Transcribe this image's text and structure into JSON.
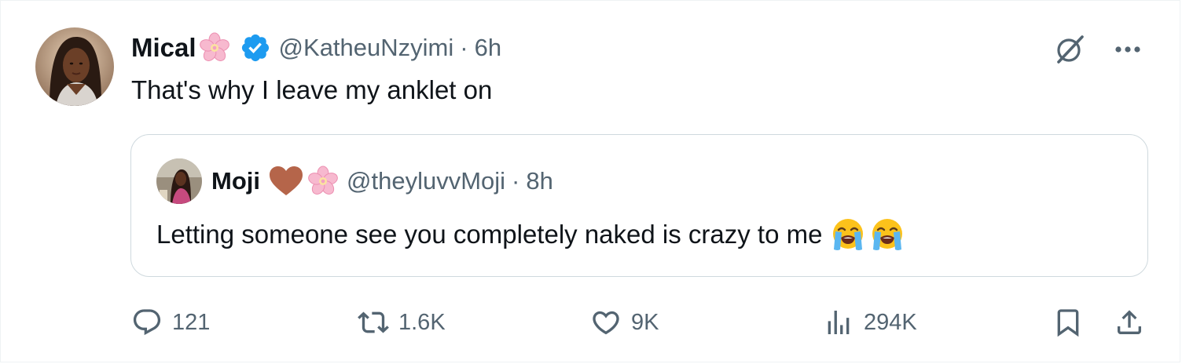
{
  "author": {
    "display_name": "Mical",
    "handle": "@KatheuNzyimi",
    "separator": "·",
    "time": "6h"
  },
  "tweet": {
    "text": "That's why I leave my anklet on"
  },
  "quoted": {
    "display_name": "Moji",
    "handle": "@theyluvvMoji",
    "separator": "·",
    "time": "8h",
    "text": "Letting someone see you completely naked is crazy to me"
  },
  "actions": {
    "replies": "121",
    "reposts": "1.6K",
    "likes": "9K",
    "views": "294K"
  },
  "icons": {
    "verified": "verified-badge-icon",
    "flower": "cherry-blossom-emoji",
    "heart": "brown-heart-emoji",
    "cry": "loudly-crying-face-emoji",
    "grok": "grok-icon",
    "more": "more-icon",
    "reply": "reply-icon",
    "repost": "repost-icon",
    "like": "heart-icon",
    "views": "views-icon",
    "bookmark": "bookmark-icon",
    "share": "share-icon"
  },
  "colors": {
    "text_primary": "#0f1419",
    "text_secondary": "#536471",
    "verified_blue": "#1d9bf0",
    "border": "#cfd9de",
    "heart_brown": "#b5654a"
  }
}
